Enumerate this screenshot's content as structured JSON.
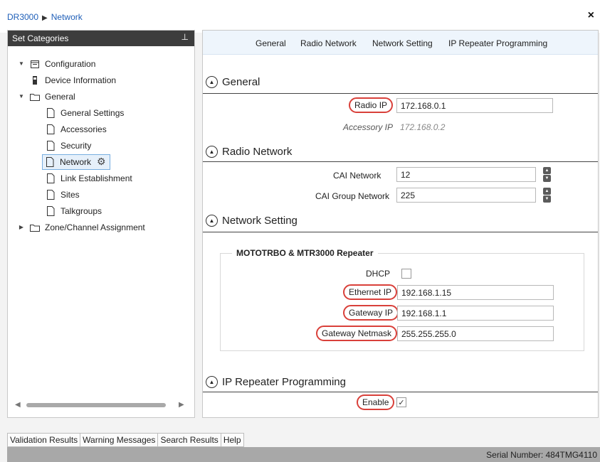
{
  "breadcrumb": {
    "root": "DR3000",
    "current": "Network"
  },
  "set_categories": {
    "title": "Set Categories",
    "tree": {
      "configuration": "Configuration",
      "device_information": "Device Information",
      "general": "General",
      "general_settings": "General Settings",
      "accessories": "Accessories",
      "security": "Security",
      "network": "Network",
      "link_establishment": "Link Establishment",
      "sites": "Sites",
      "talkgroups": "Talkgroups",
      "zone_channel_assignment": "Zone/Channel Assignment"
    }
  },
  "tabs": [
    "General",
    "Radio Network",
    "Network Setting",
    "IP Repeater Programming"
  ],
  "sections": {
    "general": {
      "title": "General",
      "radio_ip_label": "Radio IP",
      "radio_ip_value": "172.168.0.1",
      "accessory_ip_label": "Accessory IP",
      "accessory_ip_value": "172.168.0.2"
    },
    "radio_network": {
      "title": "Radio Network",
      "cai_network_label": "CAI Network",
      "cai_network_value": "12",
      "cai_group_network_label": "CAI Group Network",
      "cai_group_network_value": "225"
    },
    "network_setting": {
      "title": "Network Setting",
      "group_title": "MOTOTRBO & MTR3000 Repeater",
      "dhcp_label": "DHCP",
      "dhcp_checked": false,
      "ethernet_ip_label": "Ethernet IP",
      "ethernet_ip_value": "192.168.1.15",
      "gateway_ip_label": "Gateway IP",
      "gateway_ip_value": "192.168.1.1",
      "gateway_netmask_label": "Gateway Netmask",
      "gateway_netmask_value": "255.255.255.0"
    },
    "ip_repeater_programming": {
      "title": "IP Repeater Programming",
      "enable_label": "Enable",
      "enable_checked": true
    }
  },
  "bottom_tabs": [
    "Validation Results",
    "Warning Messages",
    "Search Results",
    "Help"
  ],
  "status": {
    "serial_number": "Serial Number: 484TMG4110"
  },
  "colors": {
    "highlight_ring": "#d9403a",
    "link": "#1f5fb8",
    "tab_bar": "#eef5fc"
  }
}
